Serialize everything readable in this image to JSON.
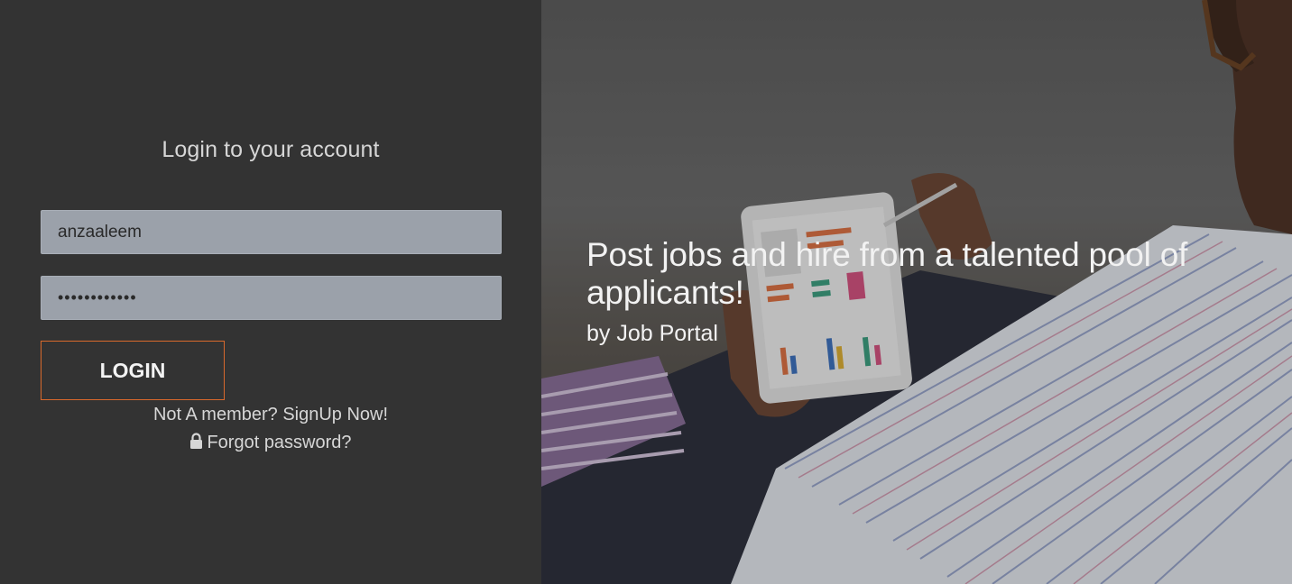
{
  "login": {
    "title": "Login to your account",
    "username_value": "anzaaleem",
    "password_value": "••••••••••••",
    "login_label": "LOGIN",
    "signup_text": "Not A member? SignUp Now!",
    "forgot_text": "Forgot password?",
    "lock_icon": "lock-icon"
  },
  "hero": {
    "heading": "Post jobs and hire from a talented pool of applicants!",
    "byline": "by Job Portal"
  },
  "colors": {
    "panel_bg": "#333333",
    "input_bg": "#9ba1aa",
    "accent": "#d9692c",
    "text_light": "#d6d6d6"
  }
}
